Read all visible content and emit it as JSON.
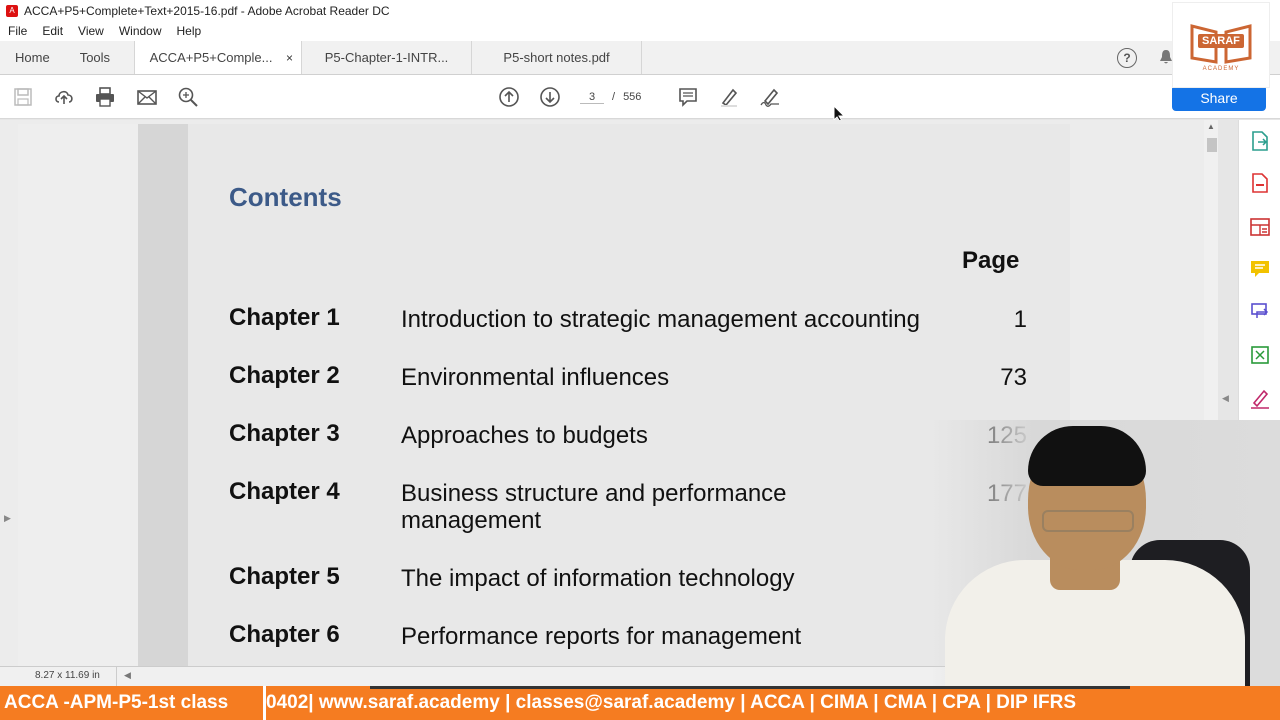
{
  "window": {
    "title": "ACCA+P5+Complete+Text+2015-16.pdf - Adobe Acrobat Reader DC",
    "minimize": "–"
  },
  "menu": [
    "File",
    "Edit",
    "View",
    "Window",
    "Help"
  ],
  "tabs": {
    "home": "Home",
    "tools": "Tools",
    "docs": [
      {
        "label": "ACCA+P5+Comple...",
        "close": "×"
      },
      {
        "label": "P5-Chapter-1-INTR..."
      },
      {
        "label": "P5-short notes.pdf"
      }
    ],
    "help": "?"
  },
  "toolbar": {
    "page_current": "3",
    "page_sep": "/",
    "page_total": "556",
    "share": "Share"
  },
  "logo": {
    "brand": "SARAF",
    "sub": "ACADEMY"
  },
  "document": {
    "contents_title": "Contents",
    "page_header": "Page",
    "toc": [
      {
        "chapter": "Chapter 1",
        "title": "Introduction to strategic management accounting",
        "page": "1"
      },
      {
        "chapter": "Chapter 2",
        "title": "Environmental influences",
        "page": "73"
      },
      {
        "chapter": "Chapter 3",
        "title": "Approaches to budgets",
        "page": "125"
      },
      {
        "chapter": "Chapter 4",
        "title": "Business structure and performance",
        "title2": "management",
        "page": "177"
      },
      {
        "chapter": "Chapter 5",
        "title": "The impact of information technology",
        "page": ""
      },
      {
        "chapter": "Chapter 6",
        "title": "Performance reports for management",
        "page": ""
      }
    ]
  },
  "status": {
    "page_size": "8.27 x 11.69 in"
  },
  "ticker": {
    "label": "ACCA -APM-P5-1st class",
    "scroll": "0402| www.saraf.academy | classes@saraf.academy |     ACCA | CIMA | CMA | CPA | DIP IFRS"
  },
  "colors": {
    "accent": "#1473e6",
    "heading": "#3c5a88",
    "ticker": "#f57c21"
  }
}
